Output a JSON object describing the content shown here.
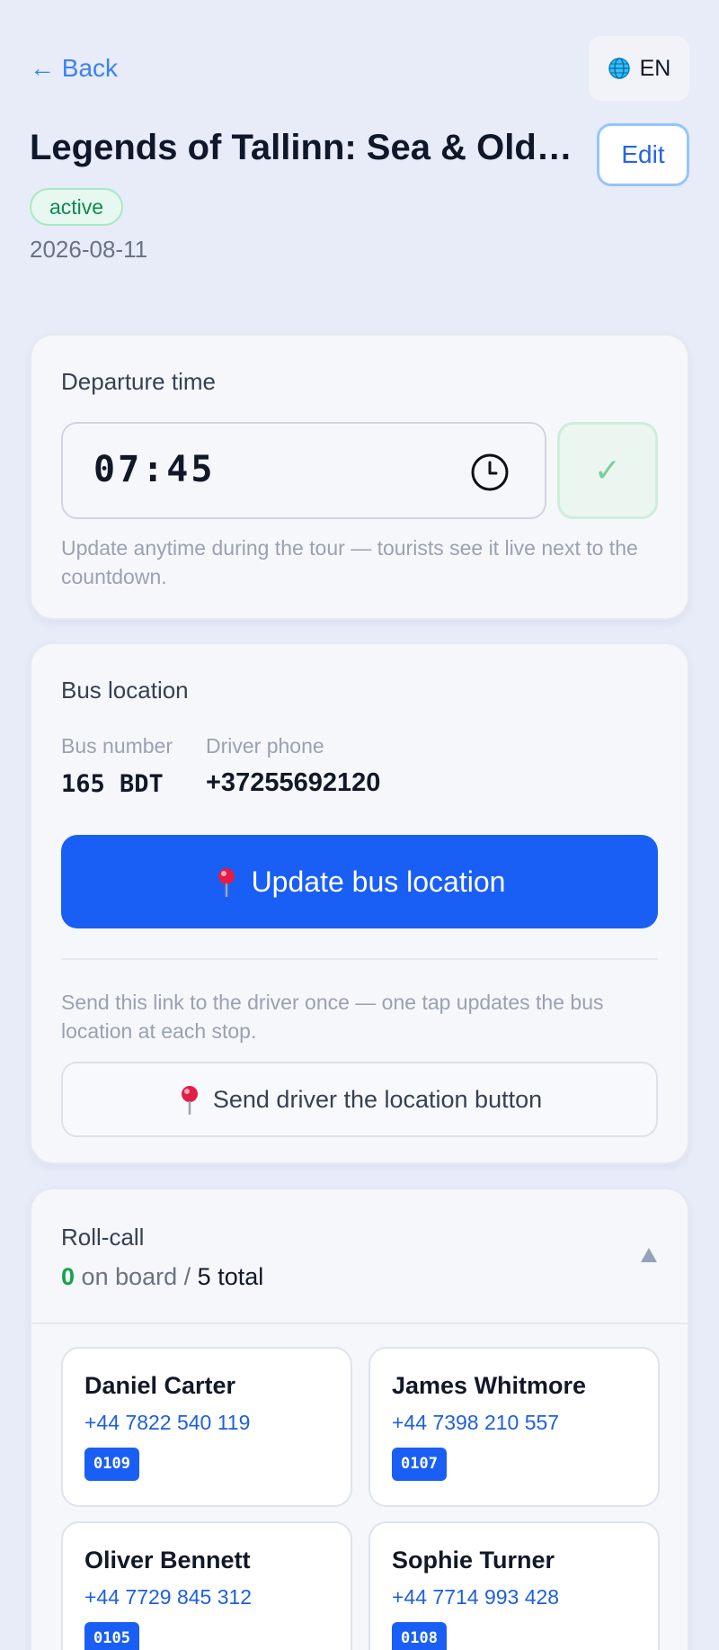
{
  "nav": {
    "back_label": "← Back",
    "language_label": "EN",
    "language_icon": "globe-icon"
  },
  "tour": {
    "title": "Legends of Tallinn: Sea & Old…",
    "edit_label": "Edit",
    "status": "active",
    "date": "2026-08-11"
  },
  "departure": {
    "title": "Departure time",
    "time_value": "07:45",
    "confirm_label": "✓",
    "help_text": "Update anytime during the tour — tourists see it live next to the countdown."
  },
  "bus": {
    "title": "Bus location",
    "bus_number_label": "Bus number",
    "bus_number_value": "165 BDT",
    "driver_phone_label": "Driver phone",
    "driver_phone_value": "+37255692120",
    "update_button_label": "Update bus location",
    "help_text": "Send this link to the driver once — one tap updates the bus location at each stop.",
    "send_button_label": "Send driver the location button"
  },
  "rollcall": {
    "title": "Roll-call",
    "on_board": "0",
    "on_board_label": "on board /",
    "total": "5",
    "total_label": "total",
    "people": [
      {
        "name": "Daniel Carter",
        "phone": "+44 7822 540 119",
        "code": "0109"
      },
      {
        "name": "James Whitmore",
        "phone": "+44 7398 210 557",
        "code": "0107"
      },
      {
        "name": "Oliver Bennett",
        "phone": "+44 7729 845 312",
        "code": "0105"
      },
      {
        "name": "Sophie Turner",
        "phone": "+44 7714 993 428",
        "code": "0108"
      }
    ]
  },
  "colors": {
    "accent": "#1a5ff5",
    "link": "#3b82f6",
    "success": "#16a34a",
    "background": "#e8ecf8"
  }
}
